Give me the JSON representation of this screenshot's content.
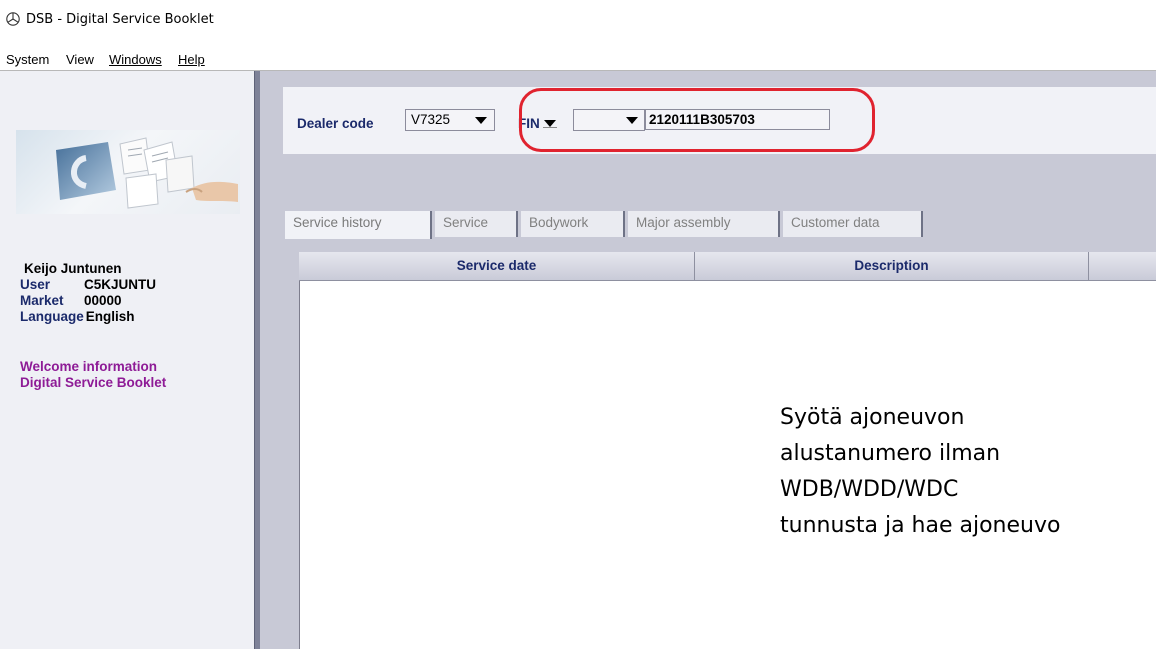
{
  "window": {
    "title": "DSB - Digital Service Booklet"
  },
  "menu": {
    "items": [
      {
        "label": "System"
      },
      {
        "label": "View"
      },
      {
        "label": "Windows"
      },
      {
        "label": "Help"
      }
    ]
  },
  "user_panel": {
    "name": "Keijo Juntunen",
    "user_label": "User",
    "user_value": "C5KJUNTU",
    "market_label": "Market",
    "market_value": "00000",
    "language_label": "Language",
    "language_value": "English",
    "links": [
      "Welcome information",
      "Digital Service Booklet"
    ]
  },
  "search": {
    "dealer_label": "Dealer code",
    "dealer_value": "V7325",
    "vin_label": "FIN",
    "vin_prefix_value": "",
    "vin_value": "2120111B305703"
  },
  "tabs": [
    {
      "label": "Service history",
      "active": true
    },
    {
      "label": "Service",
      "active": false
    },
    {
      "label": "Bodywork",
      "active": false
    },
    {
      "label": "Major assembly",
      "active": false
    },
    {
      "label": "Customer data",
      "active": false
    }
  ],
  "table": {
    "columns": [
      "Service date",
      "Description",
      ""
    ]
  },
  "annotation": {
    "lines": [
      "Syötä ajoneuvon",
      "alustanumero ilman",
      "WDB/WDD/WDC",
      "tunnusta ja hae ajoneuvo"
    ],
    "highlight_color": "#e0232f"
  },
  "colors": {
    "label_blue": "#1b2a6b",
    "link_purple": "#8e1b96",
    "pane_lavender": "#c8c9d6"
  }
}
